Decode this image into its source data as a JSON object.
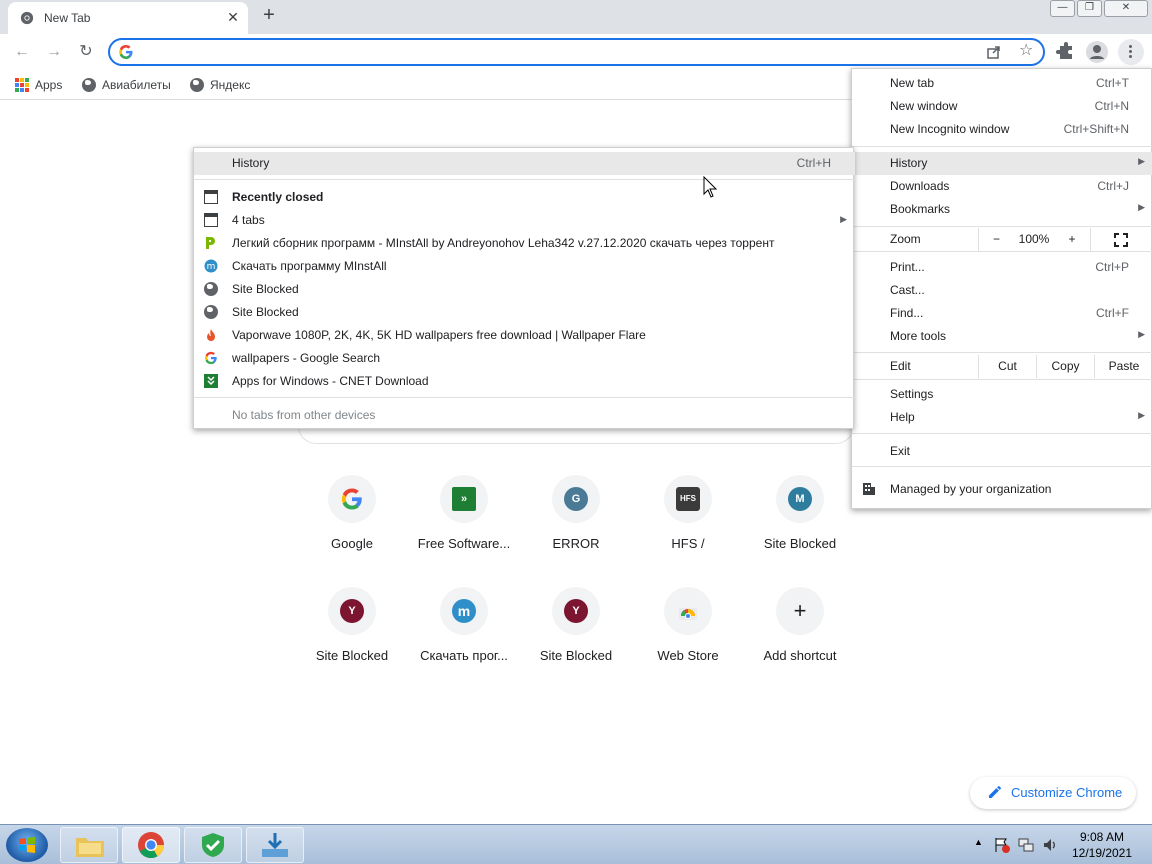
{
  "tab": {
    "title": "New Tab",
    "close": "✕",
    "new_tab": "+"
  },
  "window": {
    "minimize": "—",
    "restore": "❐",
    "close": "✕"
  },
  "toolbar": {
    "back": "←",
    "forward": "→",
    "reload": "↻",
    "star": "☆"
  },
  "omnibox": {
    "value": "",
    "placeholder": ""
  },
  "bookmarks": [
    {
      "label": "Apps"
    },
    {
      "label": "Авиабилеты"
    },
    {
      "label": "Яндекс"
    }
  ],
  "history_menu": {
    "header": {
      "label": "History",
      "shortcut": "Ctrl+H"
    },
    "recently_closed_title": "Recently closed",
    "items": [
      {
        "label": "4 tabs",
        "icon": "window-icon"
      },
      {
        "label": "Легкий сборник программ - MInstAll by Andreyonohov  Leha342 v.27.12.2020 скачать через торрент",
        "icon": "torrent-icon"
      },
      {
        "label": "Скачать программу MInstAll",
        "icon": "minstall-icon"
      },
      {
        "label": "Site Blocked",
        "icon": "globe-icon"
      },
      {
        "label": "Site Blocked",
        "icon": "globe-icon"
      },
      {
        "label": "Vaporwave 1080P, 2K, 4K, 5K HD wallpapers free download | Wallpaper Flare",
        "icon": "flame-icon"
      },
      {
        "label": "wallpapers - Google Search",
        "icon": "google-icon"
      },
      {
        "label": "Apps for Windows - CNET Download",
        "icon": "cnet-icon"
      }
    ],
    "footer": "No tabs from other devices"
  },
  "main_menu": {
    "new_tab": {
      "label": "New tab",
      "shortcut": "Ctrl+T"
    },
    "new_window": {
      "label": "New window",
      "shortcut": "Ctrl+N"
    },
    "new_incognito": {
      "label": "New Incognito window",
      "shortcut": "Ctrl+Shift+N"
    },
    "history": {
      "label": "History"
    },
    "downloads": {
      "label": "Downloads",
      "shortcut": "Ctrl+J"
    },
    "bookmarks": {
      "label": "Bookmarks"
    },
    "zoom": {
      "label": "Zoom",
      "minus": "−",
      "level": "100%",
      "plus": "+"
    },
    "print": {
      "label": "Print...",
      "shortcut": "Ctrl+P"
    },
    "cast": {
      "label": "Cast..."
    },
    "find": {
      "label": "Find...",
      "shortcut": "Ctrl+F"
    },
    "more_tools": {
      "label": "More tools"
    },
    "edit": {
      "label": "Edit",
      "cut": "Cut",
      "copy": "Copy",
      "paste": "Paste"
    },
    "settings": {
      "label": "Settings"
    },
    "help": {
      "label": "Help"
    },
    "exit": {
      "label": "Exit"
    },
    "managed": {
      "label": "Managed by your organization"
    }
  },
  "shortcuts": [
    {
      "label": "Google",
      "letter": "G",
      "color": "#ffffff"
    },
    {
      "label": "Free Software...",
      "letter": "",
      "color": "#1e7e34"
    },
    {
      "label": "ERROR",
      "letter": "G",
      "color": "#4a7a96"
    },
    {
      "label": "HFS /",
      "letter": "HFS",
      "color": "#3b3b3b"
    },
    {
      "label": "Site Blocked",
      "letter": "M",
      "color": "#2f7d9e"
    },
    {
      "label": "Site Blocked",
      "letter": "Y",
      "color": "#7b1530"
    },
    {
      "label": "Скачать прог...",
      "letter": "m",
      "color": "#2f8fc9"
    },
    {
      "label": "Site Blocked",
      "letter": "Y",
      "color": "#7b1530"
    },
    {
      "label": "Web Store",
      "letter": "",
      "color": "#ffffff"
    },
    {
      "label": "Add shortcut",
      "letter": "+",
      "color": "#f1f3f4"
    }
  ],
  "customize": {
    "label": "Customize Chrome"
  },
  "taskbar": {
    "time": "9:08 AM",
    "date": "12/19/2021"
  },
  "colors": {
    "accent": "#1a73e8",
    "menu_highlight": "#e8e8e9"
  }
}
